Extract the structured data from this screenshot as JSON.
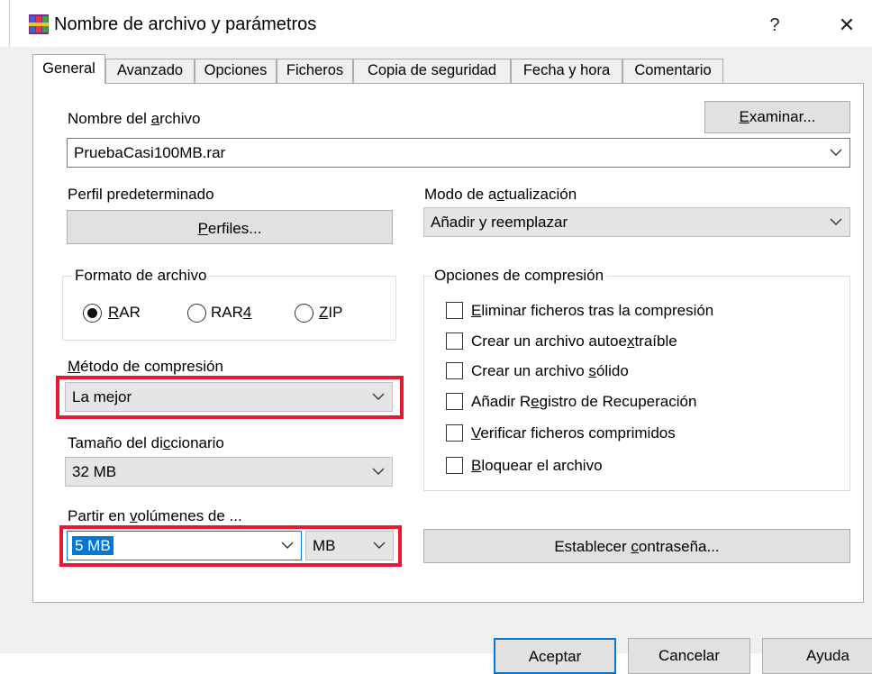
{
  "window": {
    "title": "Nombre de archivo y parámetros",
    "help_glyph": "?",
    "close_glyph": "✕"
  },
  "tabs": [
    {
      "label": "General",
      "active": true
    },
    {
      "label": "Avanzado",
      "active": false
    },
    {
      "label": "Opciones",
      "active": false
    },
    {
      "label": "Ficheros",
      "active": false
    },
    {
      "label": "Copia de seguridad",
      "active": false
    },
    {
      "label": "Fecha y hora",
      "active": false
    },
    {
      "label": "Comentario",
      "active": false
    }
  ],
  "archive_name": {
    "label_pre": "Nombre del ",
    "label_acc": "a",
    "label_post": "rchivo",
    "value": "PruebaCasi100MB.rar",
    "browse_pre": "",
    "browse_acc": "E",
    "browse_post": "xaminar..."
  },
  "profile": {
    "label": "Perfil predeterminado",
    "button_pre": "",
    "button_acc": "P",
    "button_post": "erfiles..."
  },
  "update_mode": {
    "label_pre": "Modo de a",
    "label_acc": "c",
    "label_post": "tualización",
    "value": "Añadir y reemplazar"
  },
  "archive_format": {
    "title": "Formato de archivo",
    "options": [
      {
        "pre": "",
        "acc": "R",
        "post": "AR",
        "selected": true
      },
      {
        "pre": "RAR",
        "acc": "4",
        "post": "",
        "selected": false
      },
      {
        "pre": "",
        "acc": "Z",
        "post": "IP",
        "selected": false
      }
    ]
  },
  "compression_method": {
    "label_pre": "",
    "label_acc": "M",
    "label_post": "étodo de compresión",
    "value": "La mejor"
  },
  "dictionary_size": {
    "label_pre": "Tamaño del di",
    "label_acc": "c",
    "label_post": "cionario",
    "value": "32 MB"
  },
  "split_volumes": {
    "label_pre": "Partir en ",
    "label_acc": "v",
    "label_post": "olúmenes de ...",
    "value": "5 MB",
    "unit": "MB"
  },
  "compression_options": {
    "title": "Opciones de compresión",
    "items": [
      {
        "pre": "",
        "acc": "E",
        "post": "liminar ficheros tras la compresión",
        "checked": false
      },
      {
        "pre": "Crear un archivo autoe",
        "acc": "x",
        "post": "traíble",
        "checked": false
      },
      {
        "pre": "Crear un archivo ",
        "acc": "s",
        "post": "ólido",
        "checked": false
      },
      {
        "pre": "Añadir R",
        "acc": "e",
        "post": "gistro de Recuperación",
        "checked": false
      },
      {
        "pre": "",
        "acc": "V",
        "post": "erificar ficheros comprimidos",
        "checked": false
      },
      {
        "pre": "",
        "acc": "B",
        "post": "loquear el archivo",
        "checked": false
      }
    ]
  },
  "password_button": {
    "pre": "Establecer ",
    "acc": "c",
    "post": "ontraseña..."
  },
  "footer": {
    "ok": "Aceptar",
    "cancel": "Cancelar",
    "help": "Ayuda"
  },
  "colors": {
    "highlight_frame": "#e8192c",
    "selection": "#0078d7",
    "focus_border": "#0078d7"
  }
}
